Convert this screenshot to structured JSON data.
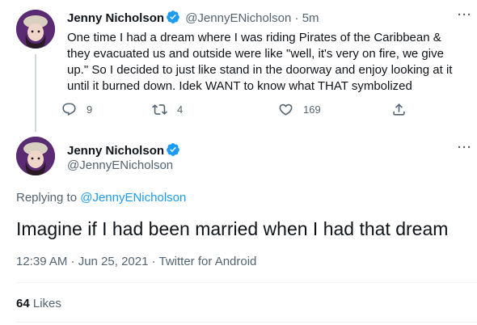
{
  "parent_tweet": {
    "name": "Jenny Nicholson",
    "handle": "@JennyENicholson",
    "separator": "·",
    "time": "5m",
    "text": "One time I had a dream where I was riding Pirates of the Caribbean & they evacuated us and outside were like \"well, it's very on fire, we give up.\" So I decided to just like stand in the doorway and enjoy looking at it until it burned down. Idek WANT to know what THAT symbolized",
    "more": "···",
    "actions": {
      "replies": "9",
      "retweets": "4",
      "likes": "169"
    }
  },
  "reply_tweet": {
    "name": "Jenny Nicholson",
    "handle": "@JennyENicholson",
    "more": "···",
    "replying_prefix": "Replying to",
    "replying_handle": "@JennyENicholson",
    "text": "Imagine if I had been married when I had that dream",
    "timestamp": "12:39 AM · Jun 25, 2021 · Twitter for Android",
    "likes_count": "64",
    "likes_label": "Likes"
  },
  "icons": {
    "verified": "verified-badge-icon",
    "reply": "reply-icon",
    "retweet": "retweet-icon",
    "like": "heart-icon",
    "share": "share-icon",
    "more": "more-icon"
  },
  "colors": {
    "accent": "#1d9bf0",
    "text": "#0f1419",
    "muted": "#536471",
    "avatar_bg": "#5a2a72"
  }
}
